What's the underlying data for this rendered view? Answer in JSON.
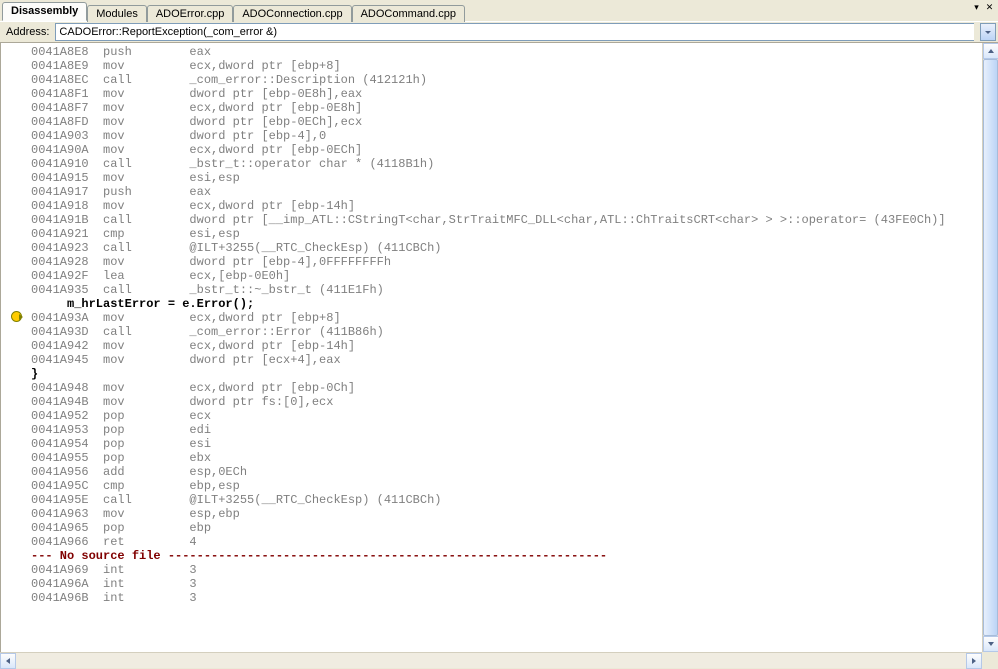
{
  "tabs": [
    {
      "label": "Disassembly",
      "active": true
    },
    {
      "label": "Modules",
      "active": false
    },
    {
      "label": "ADOError.cpp",
      "active": false
    },
    {
      "label": "ADOConnection.cpp",
      "active": false
    },
    {
      "label": "ADOCommand.cpp",
      "active": false
    }
  ],
  "address_label": "Address:",
  "address_value": "CADOError::ReportException(_com_error &)",
  "lines": [
    {
      "bp": false,
      "cls": "",
      "text": "0041A8E8  push        eax  "
    },
    {
      "bp": false,
      "cls": "",
      "text": "0041A8E9  mov         ecx,dword ptr [ebp+8] "
    },
    {
      "bp": false,
      "cls": "",
      "text": "0041A8EC  call        _com_error::Description (412121h) "
    },
    {
      "bp": false,
      "cls": "",
      "text": "0041A8F1  mov         dword ptr [ebp-0E8h],eax "
    },
    {
      "bp": false,
      "cls": "",
      "text": "0041A8F7  mov         ecx,dword ptr [ebp-0E8h] "
    },
    {
      "bp": false,
      "cls": "",
      "text": "0041A8FD  mov         dword ptr [ebp-0ECh],ecx "
    },
    {
      "bp": false,
      "cls": "",
      "text": "0041A903  mov         dword ptr [ebp-4],0 "
    },
    {
      "bp": false,
      "cls": "",
      "text": "0041A90A  mov         ecx,dword ptr [ebp-0ECh] "
    },
    {
      "bp": false,
      "cls": "",
      "text": "0041A910  call        _bstr_t::operator char * (4118B1h) "
    },
    {
      "bp": false,
      "cls": "",
      "text": "0041A915  mov         esi,esp "
    },
    {
      "bp": false,
      "cls": "",
      "text": "0041A917  push        eax  "
    },
    {
      "bp": false,
      "cls": "",
      "text": "0041A918  mov         ecx,dword ptr [ebp-14h] "
    },
    {
      "bp": false,
      "cls": "",
      "text": "0041A91B  call        dword ptr [__imp_ATL::CStringT<char,StrTraitMFC_DLL<char,ATL::ChTraitsCRT<char> > >::operator= (43FE0Ch)] "
    },
    {
      "bp": false,
      "cls": "",
      "text": "0041A921  cmp         esi,esp "
    },
    {
      "bp": false,
      "cls": "",
      "text": "0041A923  call        @ILT+3255(__RTC_CheckEsp) (411CBCh) "
    },
    {
      "bp": false,
      "cls": "",
      "text": "0041A928  mov         dword ptr [ebp-4],0FFFFFFFFh "
    },
    {
      "bp": false,
      "cls": "",
      "text": "0041A92F  lea         ecx,[ebp-0E0h] "
    },
    {
      "bp": false,
      "cls": "",
      "text": "0041A935  call        _bstr_t::~_bstr_t (411E1Fh) "
    },
    {
      "bp": false,
      "cls": "source-line",
      "text": "     m_hrLastError = e.Error();"
    },
    {
      "bp": true,
      "cls": "",
      "text": "0041A93A  mov         ecx,dword ptr [ebp+8] "
    },
    {
      "bp": false,
      "cls": "",
      "text": "0041A93D  call        _com_error::Error (411B86h) "
    },
    {
      "bp": false,
      "cls": "",
      "text": "0041A942  mov         ecx,dword ptr [ebp-14h] "
    },
    {
      "bp": false,
      "cls": "",
      "text": "0041A945  mov         dword ptr [ecx+4],eax "
    },
    {
      "bp": false,
      "cls": "source-line",
      "text": "}"
    },
    {
      "bp": false,
      "cls": "",
      "text": "0041A948  mov         ecx,dword ptr [ebp-0Ch] "
    },
    {
      "bp": false,
      "cls": "",
      "text": "0041A94B  mov         dword ptr fs:[0],ecx "
    },
    {
      "bp": false,
      "cls": "",
      "text": "0041A952  pop         ecx  "
    },
    {
      "bp": false,
      "cls": "",
      "text": "0041A953  pop         edi  "
    },
    {
      "bp": false,
      "cls": "",
      "text": "0041A954  pop         esi  "
    },
    {
      "bp": false,
      "cls": "",
      "text": "0041A955  pop         ebx  "
    },
    {
      "bp": false,
      "cls": "",
      "text": "0041A956  add         esp,0ECh "
    },
    {
      "bp": false,
      "cls": "",
      "text": "0041A95C  cmp         ebp,esp "
    },
    {
      "bp": false,
      "cls": "",
      "text": "0041A95E  call        @ILT+3255(__RTC_CheckEsp) (411CBCh) "
    },
    {
      "bp": false,
      "cls": "",
      "text": "0041A963  mov         esp,ebp "
    },
    {
      "bp": false,
      "cls": "",
      "text": "0041A965  pop         ebp  "
    },
    {
      "bp": false,
      "cls": "",
      "text": "0041A966  ret         4    "
    },
    {
      "bp": false,
      "cls": "no-source",
      "text": "--- No source file -------------------------------------------------------------"
    },
    {
      "bp": false,
      "cls": "",
      "text": "0041A969  int         3    "
    },
    {
      "bp": false,
      "cls": "",
      "text": "0041A96A  int         3    "
    },
    {
      "bp": false,
      "cls": "",
      "text": "0041A96B  int         3    "
    }
  ]
}
